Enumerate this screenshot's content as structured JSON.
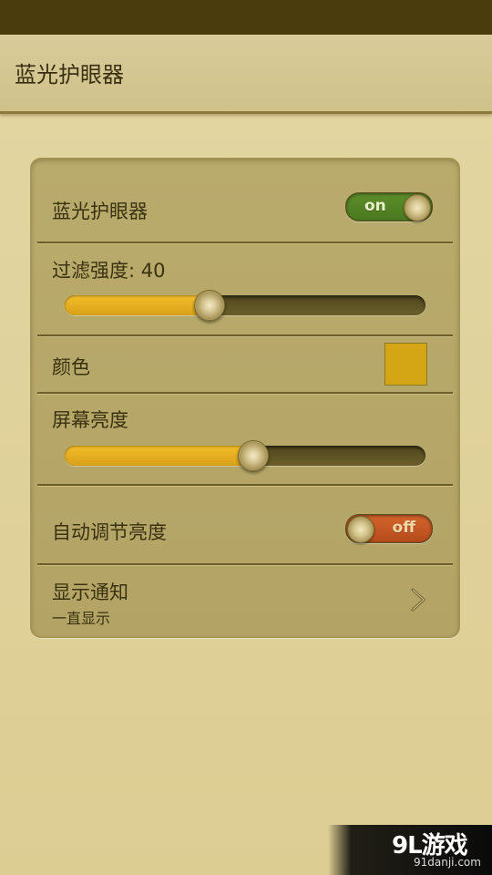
{
  "app": {
    "title": "蓝光护眼器"
  },
  "settings": {
    "eye_protection": {
      "label": "蓝光护眼器",
      "toggle_text": "on",
      "enabled": true
    },
    "filter_strength": {
      "label": "过滤强度: 40",
      "value": 40,
      "max": 100
    },
    "color": {
      "label": "颜色",
      "swatch_hex": "#d4a615"
    },
    "brightness": {
      "label": "屏幕亮度",
      "value": 52,
      "max": 100
    },
    "auto_brightness": {
      "label": "自动调节亮度",
      "toggle_text": "off",
      "enabled": false
    },
    "notification": {
      "label": "显示通知",
      "value": "一直显示"
    }
  },
  "watermark": {
    "logo": "9L游戏",
    "url": "91danji.com"
  },
  "colors": {
    "status_bar": "#4a3c0c",
    "background": "#e3d6a2",
    "card": "#b9ab6c",
    "slider_fill": "#e8ae1f",
    "toggle_on": "#5e8d2a",
    "toggle_off": "#d4642c"
  },
  "icons": {
    "knob": "brushed-metal-knob",
    "chevron": "chevron-right-icon"
  }
}
